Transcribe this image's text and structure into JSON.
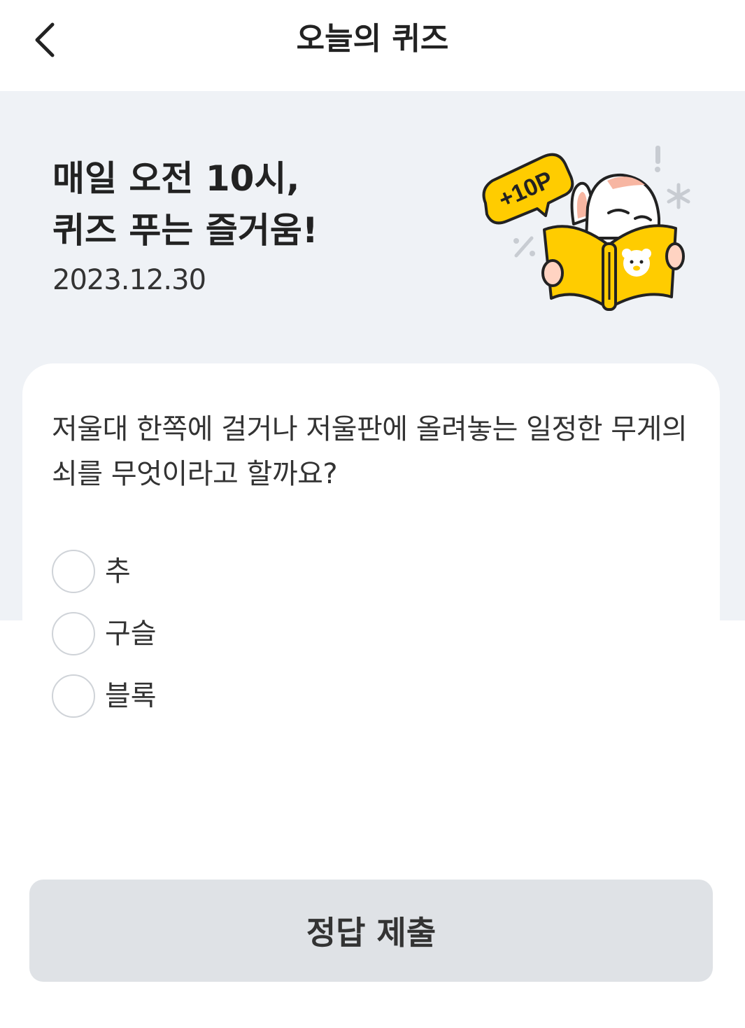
{
  "header": {
    "title": "오늘의 퀴즈",
    "back_icon": "chevron-left-icon"
  },
  "hero": {
    "title_line1": "매일 오전 10시,",
    "title_line2": "퀴즈 푸는 즐거움!",
    "date": "2023.12.30",
    "illustration": {
      "badge_text": "+10P",
      "badge_color": "#ffcc00",
      "book_color": "#ffcc00"
    }
  },
  "quiz": {
    "question": "저울대 한쪽에 걸거나 저울판에 올려놓는 일정한 무게의 쇠를 무엇이라고 할까요?",
    "options": [
      {
        "label": "추"
      },
      {
        "label": "구슬"
      },
      {
        "label": "블록"
      }
    ]
  },
  "footer": {
    "submit_label": "정답 제출"
  },
  "colors": {
    "hero_bg": "#eff2f6",
    "button_bg": "#dfe2e6",
    "accent": "#ffcc00"
  }
}
